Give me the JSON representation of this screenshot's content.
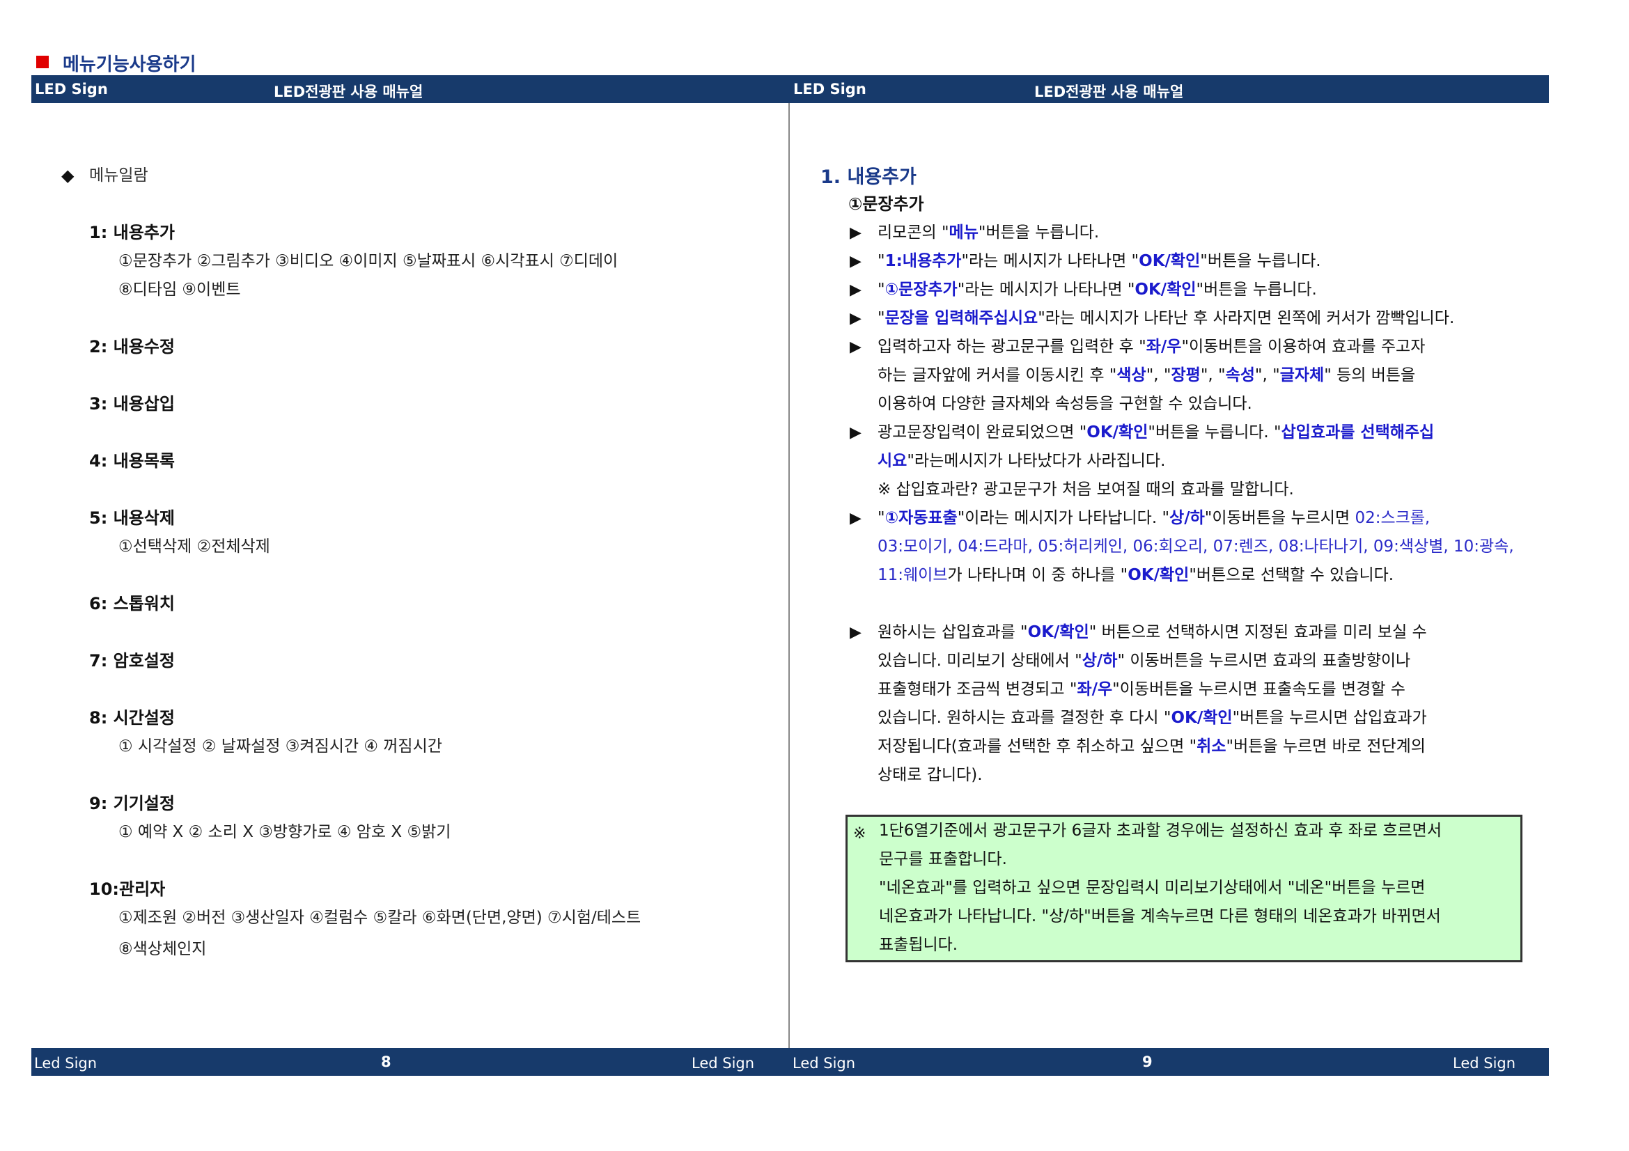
{
  "section_heading": "메뉴기능사용하기",
  "header": {
    "left": "LED Sign",
    "center": "LED전광판 사용 매뉴얼"
  },
  "footer": {
    "left": "Led  Sign",
    "right": "Led  Sign",
    "page_left": "8",
    "page_right": "9"
  },
  "left_page": {
    "list_title": "메뉴일람",
    "items": [
      {
        "title": "1: 내용추가",
        "subs": [
          "①문장추가  ②그림추가  ③비디오  ④이미지  ⑤날짜표시  ⑥시각표시  ⑦디데이",
          "⑧디타임  ⑨이벤트"
        ]
      },
      {
        "title": "2: 내용수정",
        "subs": []
      },
      {
        "title": "3: 내용삽입",
        "subs": []
      },
      {
        "title": "4: 내용목록",
        "subs": []
      },
      {
        "title": "5: 내용삭제",
        "subs": [
          "①선택삭제  ②전체삭제"
        ]
      },
      {
        "title": "6: 스톱워치",
        "subs": []
      },
      {
        "title": "7: 암호설정",
        "subs": []
      },
      {
        "title": "8: 시간설정",
        "subs": [
          "① 시각설정  ② 날짜설정  ③켜짐시간  ④ 꺼짐시간"
        ]
      },
      {
        "title": "9: 기기설정",
        "subs": [
          "① 예약 X   ② 소리 X   ③방향가로   ④ 암호 X   ⑤밝기"
        ]
      },
      {
        "title": "10:관리자",
        "subs": [
          "①제조원  ②버전  ③생산일자  ④컬럼수  ⑤칼라  ⑥화면(단면,양면)  ⑦시험/테스트",
          "⑧색상체인지"
        ]
      }
    ]
  },
  "right_page": {
    "title": "1. 내용추가",
    "subtitle": "①문장추가",
    "lines": {
      "l1a": "리모콘의 \"",
      "l1b": "메뉴",
      "l1c": "\"버튼을 누릅니다.",
      "l2a": "\"",
      "l2b": "1:내용추가",
      "l2c": "\"라는 메시지가 나타나면 \"",
      "l2d": "OK/확인",
      "l2e": "\"버튼을 누릅니다.",
      "l3a": "\"",
      "l3b": "①문장추가",
      "l3c": "\"라는 메시지가 나타나면 \"",
      "l3d": "OK/확인",
      "l3e": "\"버튼을 누릅니다.",
      "l4a": "\"",
      "l4b": "문장을 입력해주십시요",
      "l4c": "\"라는 메시지가 나타난 후 사라지면 왼쪽에 커서가 깜빡입니다.",
      "l5a": "입력하고자 하는 광고문구를 입력한 후 \"",
      "l5b": "좌/우",
      "l5c": "\"이동버튼을 이용하여 효과를 주고자",
      "l6a": "하는 글자앞에 커서를 이동시킨 후 \"",
      "l6b": "색상",
      "l6c": "\", \"",
      "l6d": "장평",
      "l6e": "\", \"",
      "l6f": "속성",
      "l6g": "\", \"",
      "l6h": "글자체",
      "l6i": "\" 등의 버튼을",
      "l7": "이용하여 다양한 글자체와 속성등을 구현할 수 있습니다.",
      "l8a": "광고문장입력이 완료되었으면 \"",
      "l8b": "OK/확인",
      "l8c": "\"버튼을 누릅니다. \"",
      "l8d": "삽입효과를 선택해주십",
      "l9a": "시요",
      "l9b": "\"라는메시지가 나타났다가 사라집니다.",
      "l10": "※ 삽입효과란? 광고문구가 처음 보여질 때의 효과를 말합니다.",
      "l11a": " \"",
      "l11b": "①자동표출",
      "l11c": "\"이라는 메시지가 나타납니다.  \"",
      "l11d": "상/하",
      "l11e": "\"이동버튼을 누르시면 ",
      "l11f": "02:스크롤,",
      "l12": "03:모이기, 04:드라마, 05:허리케인, 06:회오리, 07:렌즈, 08:나타나기, 09:색상별, 10:광속,",
      "l13a": "11:웨이브",
      "l13b": "가 나타나며 이 중 하나를 \"",
      "l13c": "OK/확인",
      "l13d": "\"버튼으로 선택할 수 있습니다.",
      "l14a": "원하시는 삽입효과를 \"",
      "l14b": "OK/확인",
      "l14c": "\" 버튼으로 선택하시면 지정된 효과를 미리 보실 수",
      "l15a": "있습니다. 미리보기 상태에서 \"",
      "l15b": "상/하",
      "l15c": "\" 이동버튼을 누르시면 효과의 표출방향이나",
      "l16a": "표출형태가 조금씩 변경되고 \"",
      "l16b": "좌/우",
      "l16c": "\"이동버튼을 누르시면 표출속도를 변경할 수",
      "l17a": "있습니다. 원하시는 효과를 결정한 후 다시 \"",
      "l17b": "OK/확인",
      "l17c": "\"버튼을 누르시면 삽입효과가",
      "l18a": "저장됩니다(효과를 선택한 후 취소하고 싶으면 \"",
      "l18b": "취소",
      "l18c": "\"버튼을 누르면 바로 전단계의",
      "l19": "상태로 갑니다)."
    },
    "note": {
      "mark": "※",
      "lines": [
        "1단6열기준에서 광고문구가 6글자 초과할 경우에는 설정하신 효과 후 좌로 흐르면서",
        "문구를 표출합니다.",
        "\"네온효과\"를 입력하고 싶으면 문장입력시 미리보기상태에서 \"네온\"버튼을 누르면",
        "네온효과가 나타납니다. \"상/하\"버튼을 계속누르면 다른 형태의 네온효과가 바뀌면서",
        "표출됩니다."
      ]
    }
  },
  "colors": {
    "bar": "#173a6b",
    "highlight": "#1a1acc",
    "note_bg": "#ccffcc",
    "marker": "#e00000"
  }
}
